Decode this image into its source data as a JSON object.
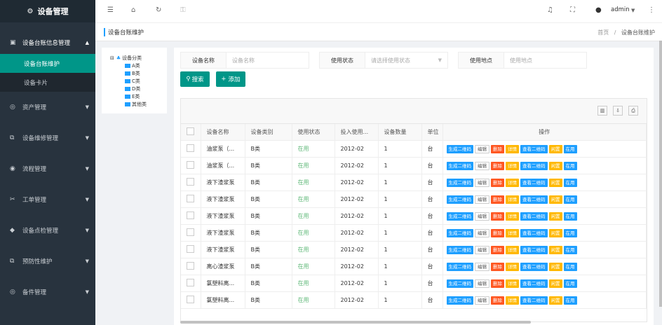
{
  "app": {
    "title": "设备管理"
  },
  "sidebar": {
    "items": [
      {
        "label": "设备台账信息管理",
        "icon": "book-icon",
        "open": true,
        "children": [
          {
            "label": "设备台账维护",
            "active": true
          },
          {
            "label": "设备卡片",
            "active": false
          }
        ]
      },
      {
        "label": "资产管理",
        "icon": "coin-icon"
      },
      {
        "label": "设备维修管理",
        "icon": "wrench-icon"
      },
      {
        "label": "流程管理",
        "icon": "flow-icon"
      },
      {
        "label": "工单管理",
        "icon": "ticket-icon"
      },
      {
        "label": "设备点检管理",
        "icon": "check-icon"
      },
      {
        "label": "预防性维护",
        "icon": "shield-icon"
      },
      {
        "label": "备件管理",
        "icon": "box-icon"
      }
    ]
  },
  "topbar": {
    "user": "admin"
  },
  "breadcrumb": {
    "page_title": "设备台账维护",
    "home": "首页",
    "separator": "/",
    "current": "设备台账维护"
  },
  "tree": {
    "root": "设备分类",
    "nodes": [
      "A类",
      "B类",
      "C类",
      "D类",
      "E类",
      "其他类"
    ]
  },
  "search": {
    "name_label": "设备名称",
    "name_placeholder": "设备名称",
    "status_label": "使用状态",
    "status_placeholder": "请选择使用状态",
    "location_label": "使用地点",
    "location_placeholder": "使用地点",
    "search_button": "搜索",
    "add_button": "添加"
  },
  "table": {
    "columns": [
      "设备名称",
      "设备类别",
      "使用状态",
      "投入使用...",
      "设备数量",
      "单位",
      "操作"
    ],
    "actions": [
      "生成二维码",
      "编辑",
      "删除",
      "详情",
      "查看二维码",
      "闲置",
      "在用"
    ],
    "rows": [
      {
        "name": "油浆泵（...",
        "category": "B类",
        "status": "在用",
        "date": "2012-02",
        "qty": "1",
        "unit": "台"
      },
      {
        "name": "油浆泵（...",
        "category": "B类",
        "status": "在用",
        "date": "2012-02",
        "qty": "1",
        "unit": "台"
      },
      {
        "name": "液下渣浆泵",
        "category": "B类",
        "status": "在用",
        "date": "2012-02",
        "qty": "1",
        "unit": "台"
      },
      {
        "name": "液下渣浆泵",
        "category": "B类",
        "status": "在用",
        "date": "2012-02",
        "qty": "1",
        "unit": "台"
      },
      {
        "name": "液下渣浆泵",
        "category": "B类",
        "status": "在用",
        "date": "2012-02",
        "qty": "1",
        "unit": "台"
      },
      {
        "name": "液下渣浆泵",
        "category": "B类",
        "status": "在用",
        "date": "2012-02",
        "qty": "1",
        "unit": "台"
      },
      {
        "name": "液下渣浆泵",
        "category": "B类",
        "status": "在用",
        "date": "2012-02",
        "qty": "1",
        "unit": "台"
      },
      {
        "name": "离心渣浆泵",
        "category": "B类",
        "status": "在用",
        "date": "2012-02",
        "qty": "1",
        "unit": "台"
      },
      {
        "name": "氯塑料离...",
        "category": "B类",
        "status": "在用",
        "date": "2012-02",
        "qty": "1",
        "unit": "台"
      },
      {
        "name": "氯塑料离...",
        "category": "B类",
        "status": "在用",
        "date": "2012-02",
        "qty": "1",
        "unit": "台"
      }
    ]
  },
  "colors": {
    "sidebar": "#28333e",
    "accent": "#009688",
    "blue": "#1e9fff",
    "red": "#ff5722",
    "yellow": "#ffb800",
    "green": "#5fb878"
  }
}
